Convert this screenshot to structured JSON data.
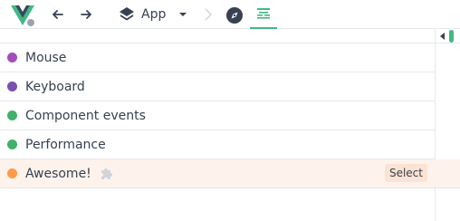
{
  "toolbar": {
    "app_select_label": "App",
    "logo_icon": "vue-logo-icon",
    "back_icon": "arrow-left-icon",
    "forward_icon": "arrow-right-icon",
    "layers_icon": "layers-icon",
    "dropdown_icon": "caret-down-icon",
    "chevron_icon": "chevron-right-icon",
    "compass_icon": "compass-icon",
    "timeline_icon": "timeline-icon"
  },
  "layers": [
    {
      "label": "Mouse",
      "color": "#a44cbb"
    },
    {
      "label": "Keyboard",
      "color": "#7b4fb0"
    },
    {
      "label": "Component events",
      "color": "#41b06b"
    },
    {
      "label": "Performance",
      "color": "#41b06b"
    },
    {
      "label": "Awesome!",
      "color": "#ff9a47",
      "plugin_icon": "puzzle-icon",
      "select_label": "Select"
    }
  ],
  "colors": {
    "accent": "#42b883",
    "highlight_row": "#fef3ec"
  }
}
